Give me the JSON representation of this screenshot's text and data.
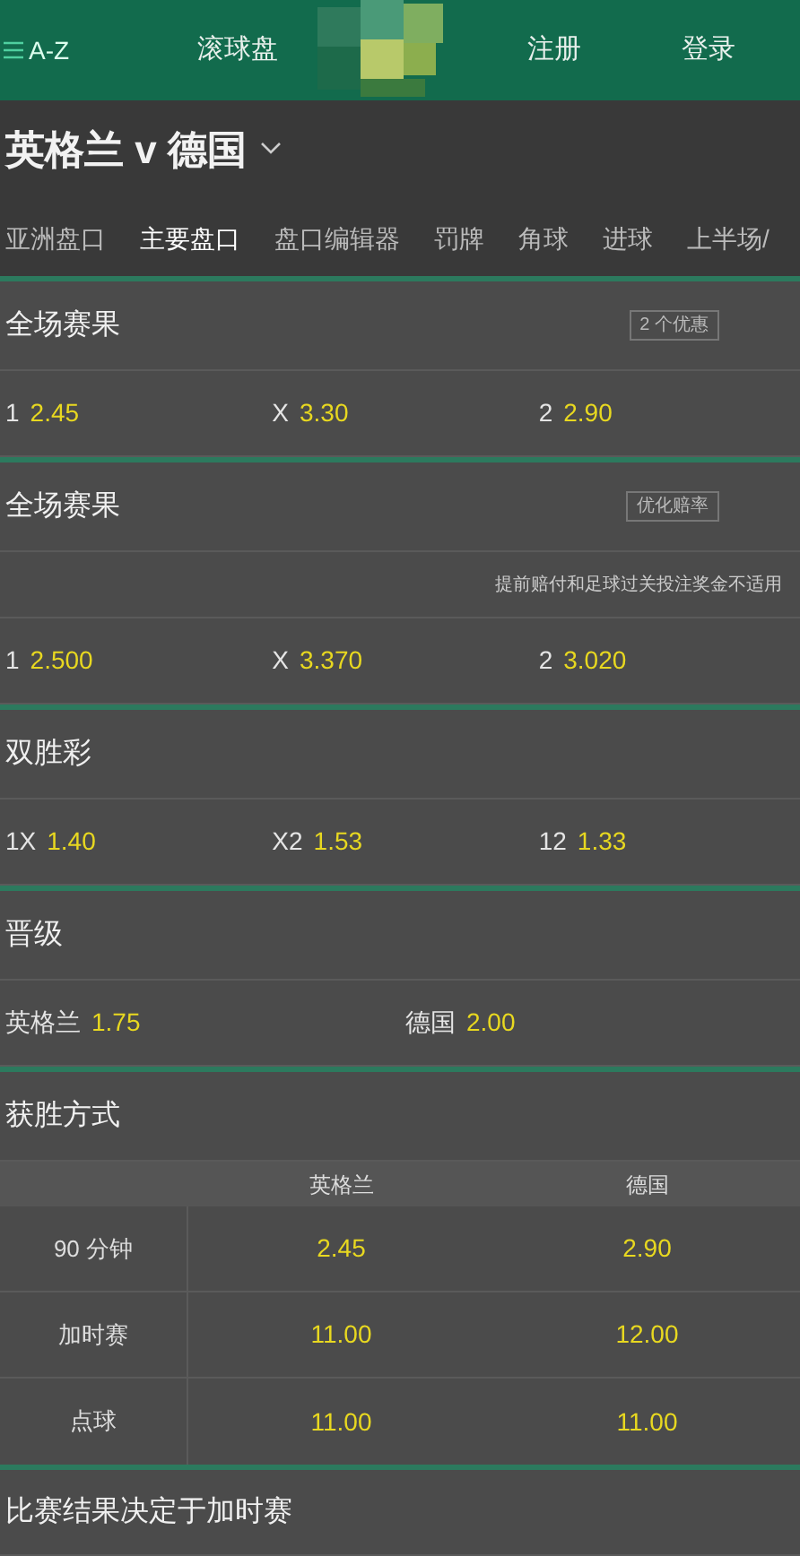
{
  "header": {
    "menu": "A-Z",
    "items": [
      "滚球盘",
      "注册",
      "登录"
    ]
  },
  "event": {
    "title": "英格兰 v 德国"
  },
  "tabs": [
    {
      "label": "亚洲盘口",
      "selected": false
    },
    {
      "label": "主要盘口",
      "selected": true
    },
    {
      "label": "盘口编辑器",
      "selected": false
    },
    {
      "label": "罚牌",
      "selected": false
    },
    {
      "label": "角球",
      "selected": false
    },
    {
      "label": "进球",
      "selected": false
    },
    {
      "label": "上半场/",
      "selected": false
    }
  ],
  "markets": [
    {
      "kind": "odds",
      "title": "全场赛果",
      "badge": "2 个优惠",
      "selections": [
        {
          "label": "1",
          "odds": "2.45"
        },
        {
          "label": "X",
          "odds": "3.30"
        },
        {
          "label": "2",
          "odds": "2.90"
        }
      ]
    },
    {
      "kind": "odds",
      "title": "全场赛果",
      "badge": "优化赔率",
      "note": "提前赔付和足球过关投注奖金不适用",
      "selections": [
        {
          "label": "1",
          "odds": "2.500"
        },
        {
          "label": "X",
          "odds": "3.370"
        },
        {
          "label": "2",
          "odds": "3.020"
        }
      ]
    },
    {
      "kind": "odds",
      "title": "双胜彩",
      "selections": [
        {
          "label": "1X",
          "odds": "1.40"
        },
        {
          "label": "X2",
          "odds": "1.53"
        },
        {
          "label": "12",
          "odds": "1.33"
        }
      ]
    },
    {
      "kind": "odds",
      "title": "晋级",
      "selections": [
        {
          "label": "英格兰",
          "odds": "1.75"
        },
        {
          "label": "德国",
          "odds": "2.00"
        }
      ]
    },
    {
      "kind": "table",
      "title": "获胜方式",
      "columns": [
        "英格兰",
        "德国"
      ],
      "rows": [
        {
          "label": "90 分钟",
          "odds": [
            "2.45",
            "2.90"
          ]
        },
        {
          "label": "加时赛",
          "odds": [
            "11.00",
            "12.00"
          ]
        },
        {
          "label": "点球",
          "odds": [
            "11.00",
            "11.00"
          ]
        }
      ]
    },
    {
      "kind": "title",
      "title": "比赛结果决定于加时赛"
    }
  ]
}
